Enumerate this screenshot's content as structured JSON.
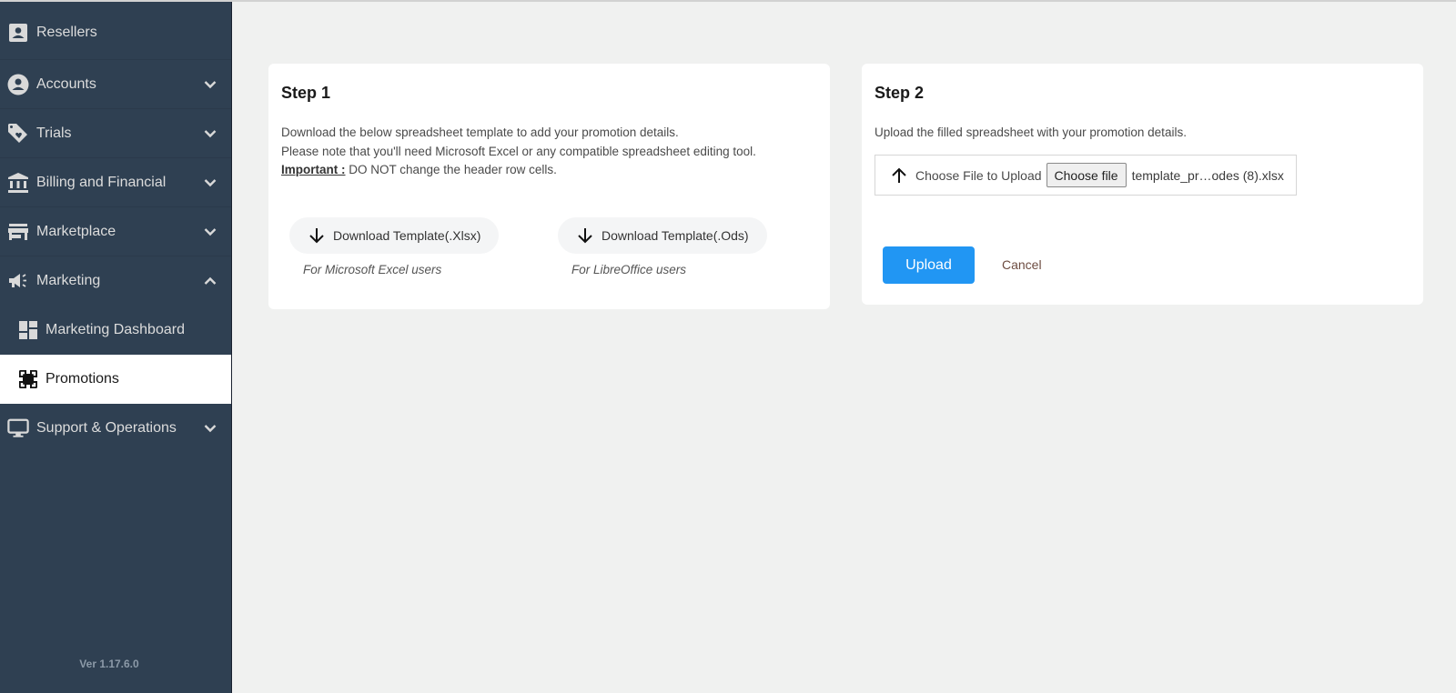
{
  "sidebar": {
    "items": [
      {
        "label": "Resellers",
        "icon": "contact-card-icon",
        "expandable": false
      },
      {
        "label": "Accounts",
        "icon": "account-circle-icon",
        "expandable": true,
        "expanded": false
      },
      {
        "label": "Trials",
        "icon": "tag-heart-icon",
        "expandable": true,
        "expanded": false
      },
      {
        "label": "Billing and Financial",
        "icon": "bank-icon",
        "expandable": true,
        "expanded": false
      },
      {
        "label": "Marketplace",
        "icon": "store-icon",
        "expandable": true,
        "expanded": false
      },
      {
        "label": "Marketing",
        "icon": "megaphone-icon",
        "expandable": true,
        "expanded": true,
        "children": [
          {
            "label": "Marketing Dashboard",
            "icon": "dashboard-icon"
          },
          {
            "label": "Promotions",
            "icon": "promotions-icon",
            "active": true
          }
        ]
      },
      {
        "label": "Support & Operations",
        "icon": "monitor-icon",
        "expandable": true,
        "expanded": false
      }
    ],
    "version": "Ver 1.17.6.0"
  },
  "step1": {
    "title": "Step 1",
    "line1": "Download the below spreadsheet template to add your promotion details.",
    "line2": "Please note that you'll need Microsoft Excel or any compatible spreadsheet editing tool.",
    "important_label": "Important :",
    "important_text": " DO NOT change the header row cells.",
    "downloads": [
      {
        "label": "Download Template(.Xlsx)",
        "hint": "For Microsoft Excel users"
      },
      {
        "label": "Download Template(.Ods)",
        "hint": "For LibreOffice users"
      }
    ]
  },
  "step2": {
    "title": "Step 2",
    "description": "Upload the filled spreadsheet with your promotion details.",
    "choose_label": "Choose File to Upload",
    "choose_button": "Choose file",
    "file_name": "template_pr…odes (8).xlsx",
    "upload_button": "Upload",
    "cancel_button": "Cancel"
  },
  "colors": {
    "sidebar_bg": "#2f4052",
    "primary": "#2196f3",
    "cancel": "#6d4c41"
  }
}
